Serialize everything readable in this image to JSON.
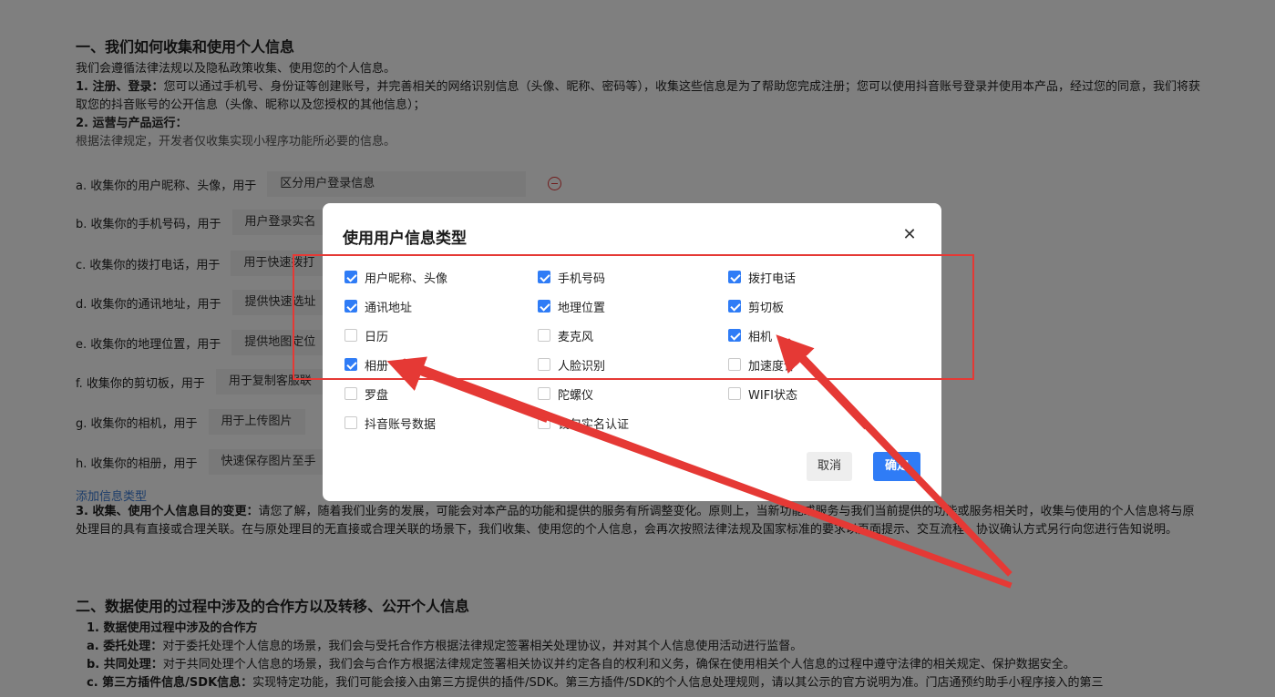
{
  "background": {
    "section1_title": "一、我们如何收集和使用个人信息",
    "section1_intro": "我们会遵循法律法规以及隐私政策收集、使用您的个人信息。",
    "item1_label": "1. 注册、登录：",
    "item1_text": "您可以通过手机号、身份证等创建账号，并完善相关的网络识别信息（头像、昵称、密码等），收集这些信息是为了帮助您完成注册；您可以使用抖音账号登录并使用本产品，经过您的同意，我们将获取您的抖音账号的公开信息（头像、昵称以及您授权的其他信息）；",
    "item2_label": "2. 运营与产品运行：",
    "item2_text": "根据法律规定，开发者仅收集实现小程序功能所必要的信息。",
    "rows": [
      {
        "label": "a. 收集你的用户昵称、头像，用于",
        "value": "区分用户登录信息"
      },
      {
        "label": "b. 收集你的手机号码，用于",
        "value": "用户登录实名"
      },
      {
        "label": "c. 收集你的拨打电话，用于",
        "value": "用于快速拨打"
      },
      {
        "label": "d. 收集你的通讯地址，用于",
        "value": "提供快速选址"
      },
      {
        "label": "e. 收集你的地理位置，用于",
        "value": "提供地图定位"
      },
      {
        "label": "f. 收集你的剪切板，用于",
        "value": "用于复制客服联"
      },
      {
        "label": "g. 收集你的相机，用于",
        "value": "用于上传图片"
      },
      {
        "label": "h. 收集你的相册，用于",
        "value": "快速保存图片至手"
      }
    ],
    "add_link": "添加信息类型",
    "item3_label": "3. 收集、使用个人信息目的变更：",
    "item3_text": "请您了解，随着我们业务的发展，可能会对本产品的功能和提供的服务有所调整变化。原则上，当新功能或服务与我们当前提供的功能或服务相关时，收集与使用的个人信息将与原处理目的具有直接或合理关联。在与原处理目的无直接或合理关联的场景下，我们收集、使用您的个人信息，会再次按照法律法规及国家标准的要求以页面提示、交互流程、协议确认方式另行向您进行告知说明。",
    "section2_title": "二、数据使用的过程中涉及的合作方以及转移、公开个人信息",
    "s2_sub1": "1. 数据使用过程中涉及的合作方",
    "s2_a_label": "a. 委托处理：",
    "s2_a_text": "对于委托处理个人信息的场景，我们会与受托合作方根据法律规定签署相关处理协议，并对其个人信息使用活动进行监督。",
    "s2_b_label": "b. 共同处理：",
    "s2_b_text": "对于共同处理个人信息的场景，我们会与合作方根据法律规定签署相关协议并约定各自的权利和义务，确保在使用相关个人信息的过程中遵守法律的相关规定、保护数据安全。",
    "s2_c_label": "c. 第三方插件信息/SDK信息：",
    "s2_c_text": "实现特定功能，我们可能会接入由第三方提供的插件/SDK。第三方插件/SDK的个人信息处理规则，请以其公示的官方说明为准。门店通预约助手小程序接入的第三"
  },
  "modal": {
    "title": "使用用户信息类型",
    "close_symbol": "✕",
    "options": [
      {
        "label": "用户昵称、头像",
        "checked": true
      },
      {
        "label": "手机号码",
        "checked": true
      },
      {
        "label": "拨打电话",
        "checked": true
      },
      {
        "label": "通讯地址",
        "checked": true
      },
      {
        "label": "地理位置",
        "checked": true
      },
      {
        "label": "剪切板",
        "checked": true
      },
      {
        "label": "日历",
        "checked": false
      },
      {
        "label": "麦克风",
        "checked": false
      },
      {
        "label": "相机",
        "checked": true
      },
      {
        "label": "相册",
        "checked": true
      },
      {
        "label": "人脸识别",
        "checked": false
      },
      {
        "label": "加速度计",
        "checked": false
      },
      {
        "label": "罗盘",
        "checked": false
      },
      {
        "label": "陀螺仪",
        "checked": false
      },
      {
        "label": "WIFI状态",
        "checked": false
      },
      {
        "label": "抖音账号数据",
        "checked": false
      },
      {
        "label": "钱包实名认证",
        "checked": false
      }
    ],
    "cancel_label": "取消",
    "confirm_label": "确定"
  },
  "colors": {
    "accent": "#2f7cf6",
    "annotation_red": "#e53935",
    "link": "#3a7bd5"
  }
}
